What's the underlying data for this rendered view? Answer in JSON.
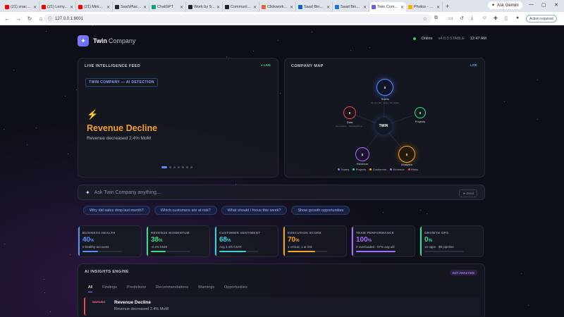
{
  "browser": {
    "tabs": [
      {
        "title": "(21) snacki...",
        "color": "#ff0000"
      },
      {
        "title": "(21) Lemy...",
        "color": "#ff0000"
      },
      {
        "title": "(21) Mini...",
        "color": "#ff0000"
      },
      {
        "title": "SaaSPlace...",
        "color": "#24292e"
      },
      {
        "title": "ChatGPT",
        "color": "#10a37f"
      },
      {
        "title": "Work by S...",
        "color": "#222222"
      },
      {
        "title": "Communi...",
        "color": "#222222"
      },
      {
        "title": "Clickworke...",
        "color": "#e8603c"
      },
      {
        "title": "Saad Bin...",
        "color": "#0a66c2"
      },
      {
        "title": "Saad Bin...",
        "color": "#1a73e8"
      },
      {
        "title": "Twin Com...",
        "color": "#6b5cf0"
      },
      {
        "title": "Photos - G...",
        "color": "#f4b400"
      }
    ],
    "ask_gemini": "Ask Gemini",
    "url": "127.0.0.1:8001",
    "action_required": "Action required"
  },
  "header": {
    "brand_bold": "Twin",
    "brand_rest": "Company",
    "status": "Online",
    "version": "v4.0.0 STABLE",
    "time": "12:47 AM"
  },
  "feed": {
    "title": "LIVE INTELLIGENCE FEED",
    "live": "● LIVE",
    "badge": "TWIN COMPANY — AI DETECTION",
    "headline": "Revenue Decline",
    "description": "Revenue decreased 2.4% MoM"
  },
  "map": {
    "title": "COMPANY MAP",
    "live": "LIVE",
    "center": "TWIN",
    "nodes": {
      "teams": {
        "value": "0",
        "label": "Teams",
        "sub": "0h, 0m, 0hr, nodes, 0hr online"
      },
      "data": {
        "value": "0",
        "label": "Data",
        "sub": "Generating..., Standardizing..."
      },
      "projects": {
        "value": "0",
        "label": "Projects"
      },
      "revenue": {
        "value": "0",
        "label": "Revenue"
      },
      "analytics": {
        "value": "0",
        "label": "Analytics"
      }
    },
    "legend": [
      {
        "label": "Teams",
        "color": "#5b8cff"
      },
      {
        "label": "Projects",
        "color": "#3ddc97"
      },
      {
        "label": "Customers",
        "color": "#f5a524"
      },
      {
        "label": "Revenue",
        "color": "#a66bff"
      },
      {
        "label": "Risks",
        "color": "#e5484d"
      }
    ]
  },
  "ask": {
    "placeholder": "Ask Twin Company anything...",
    "send": "Send",
    "suggestions": [
      "Why did sales drop last month?",
      "Which customers are at risk?",
      "What should I focus this week?",
      "Show growth opportunities"
    ]
  },
  "metrics": [
    {
      "label": "BUSINESS HEALTH",
      "value": "40",
      "unit": "%",
      "sub": "0 healthy accounts",
      "color": "#5b8cff",
      "fill": 0.4
    },
    {
      "label": "REVENUE MOMENTUM",
      "value": "38",
      "unit": "%",
      "sub": "-2.4% MoM",
      "color": "#3ddc84",
      "fill": 0.38
    },
    {
      "label": "CUSTOMER SENTIMENT",
      "value": "68",
      "unit": "%",
      "sub": "Avg 3.4/5 CSAT",
      "color": "#3ad0e0",
      "fill": 0.68
    },
    {
      "label": "EXECUTION SCORE",
      "value": "70",
      "unit": "%",
      "sub": "1 critical, 1 at risk",
      "color": "#f5a524",
      "fill": 0.7
    },
    {
      "label": "TEAM PERFORMANCE",
      "value": "100",
      "unit": "%",
      "sub": "0 overloaded · 57% avg util",
      "color": "#a66bff",
      "fill": 1.0
    },
    {
      "label": "GROWTH OPS",
      "value": "0",
      "unit": "%",
      "sub": "12 opps · $9 pipeline",
      "color": "#3ddc97",
      "fill": 0.0
    }
  ],
  "insights": {
    "title": "AI INSIGHTS ENGINE",
    "badge": "24/7 ANALYSIS",
    "tabs": [
      "All",
      "Findings",
      "Predictions",
      "Recommendations",
      "Warnings",
      "Opportunities"
    ],
    "item": {
      "tag": "WARNING",
      "title": "Revenue Decline",
      "desc": "Revenue decreased 2.4% MoM"
    }
  }
}
